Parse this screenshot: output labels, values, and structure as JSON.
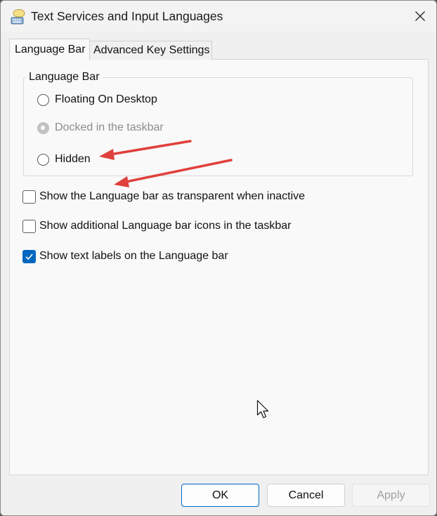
{
  "window": {
    "title": "Text Services and Input Languages"
  },
  "tabs": [
    {
      "label": "Language Bar",
      "active": true
    },
    {
      "label": "Advanced Key Settings",
      "active": false
    }
  ],
  "language_bar_group": {
    "label": "Language Bar",
    "options": [
      {
        "label": "Floating On Desktop",
        "selected": false,
        "enabled": true
      },
      {
        "label": "Docked in the taskbar",
        "selected": true,
        "enabled": false
      },
      {
        "label": "Hidden",
        "selected": false,
        "enabled": true
      }
    ]
  },
  "checkboxes": [
    {
      "label": "Show the Language bar as transparent when inactive",
      "checked": false
    },
    {
      "label": "Show additional Language bar icons in the taskbar",
      "checked": false
    },
    {
      "label": "Show text labels on the Language bar",
      "checked": true
    }
  ],
  "buttons": {
    "ok": "OK",
    "cancel": "Cancel",
    "apply": "Apply"
  },
  "colors": {
    "accent": "#0067c0",
    "annotation_arrow": "#e0403c"
  },
  "icons": {
    "title": "keyboard-speech-bubble-icon",
    "close": "close-icon",
    "pointer": "mouse-pointer-icon"
  }
}
